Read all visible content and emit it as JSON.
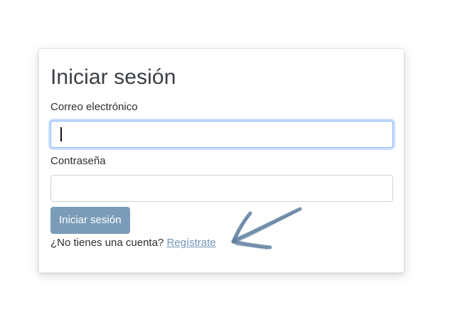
{
  "login": {
    "title": "Iniciar sesión",
    "email_label": "Correo electrónico",
    "email_value": "",
    "password_label": "Contraseña",
    "password_value": "",
    "submit_label": "Iniciar sesión",
    "signup_prompt": "¿No tienes una cuenta?",
    "signup_link": "Regístrate"
  },
  "colors": {
    "button": "#7b9cb8",
    "link": "#6f95b8",
    "focus_ring": "#86b7fe",
    "arrow": "#5f7f9f"
  },
  "icons": {
    "annotation_arrow": "hand-drawn-arrow-icon"
  }
}
